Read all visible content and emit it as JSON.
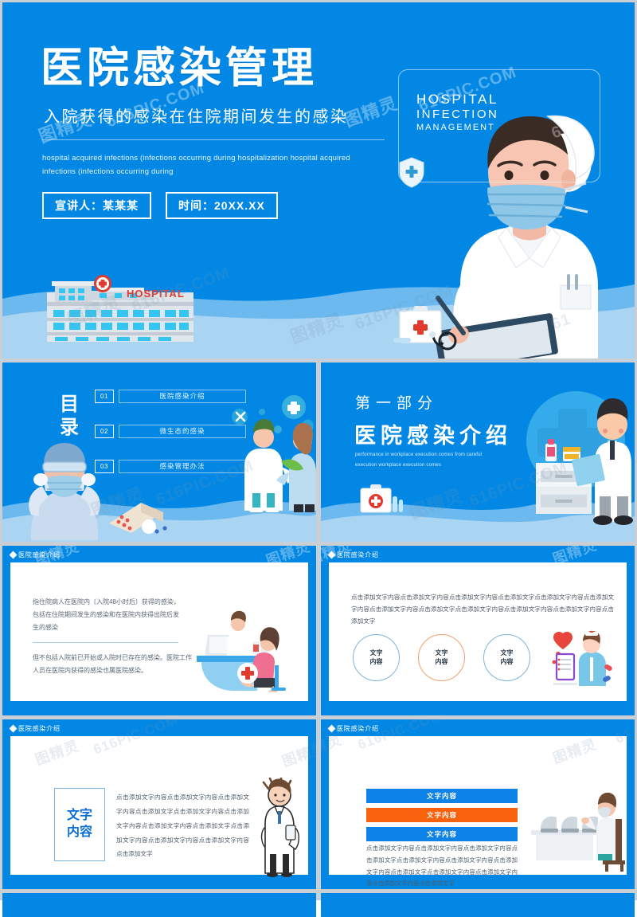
{
  "theme": {
    "primary_blue": "#0288e4",
    "deep_blue": "#0d83e8",
    "orange": "#f9620c",
    "wave_light": "#a9d4f2",
    "white": "#ffffff",
    "body_text": "#4d5a68"
  },
  "watermark": {
    "cn": "图精灵",
    "site": "616PIC.COM",
    "short": "61"
  },
  "title_slide": {
    "main_title": "医院感染管理",
    "sub_title": "入院获得的感染在住院期间发生的感染",
    "english_paragraph": "hospital acquired infections (infections occurring during hospitalization hospital acquired infections (infections occurring during",
    "speaker_tag": "宣讲人：某某某",
    "date_tag": "时间：20XX.XX",
    "panel_line1": "HOSPITAL",
    "panel_line2": "INFECTION",
    "panel_line3": "MANAGEMENT",
    "hospital_sign": "HOSPITAL"
  },
  "toc_slide": {
    "heading": "目录",
    "items": [
      {
        "number": "01",
        "label": "医院感染介绍"
      },
      {
        "number": "02",
        "label": "微生态的感染"
      },
      {
        "number": "03",
        "label": "感染管理办法"
      }
    ]
  },
  "section_slide": {
    "part_label": "第一部分",
    "part_title": "医院感染介绍",
    "english": "performance in workplace execution comes from careful execution workplace execution comes"
  },
  "content_slides": [
    {
      "tag": "医院感染介绍",
      "paragraph_1": "指住院病人在医院内〔入院48小时后〕获得的感染，包括在住院期间发生的感染和在医院内获得出院后发生的感染",
      "paragraph_2": "但不包括入院前已开始或入院时已存在的感染。医院工作人员在医院内获得的感染也属医院感染。"
    },
    {
      "tag": "医院感染介绍",
      "paragraph": "点击添加文字内容点击添加文字内容点击添加文字内容点击添加文字点击添加文字内容点击添加文字内容点击添加文字内容点击添加文字点击添加文字内容点击添加文字内容点击添加文字内容点击添加文字",
      "circles": [
        "文字\n内容",
        "文字\n内容",
        "文字\n内容"
      ],
      "circle_labels": [
        {
          "line1": "文字",
          "line2": "内容"
        },
        {
          "line1": "文字",
          "line2": "内容"
        },
        {
          "line1": "文字",
          "line2": "内容"
        }
      ]
    },
    {
      "tag": "医院感染介绍",
      "box_line1": "文字",
      "box_line2": "内容",
      "paragraph": "点击添加文字内容点击添加文字内容点击添加文字内容点击添加文字点击添加文字内容点击添加文字内容点击添加文字内容点击添加文字点击添加文字内容点击添加文字内容点击添加文字内容点击添加文字"
    },
    {
      "tag": "医院感染介绍",
      "bars": [
        "文字内容",
        "文字内容",
        "文字内容"
      ],
      "paragraph": "点击添加文字内容点击添加文字内容点击添加文字内容点击添加文字点击添加文字内容点击添加文字内容点击添加文字内容点击添加文字点击添加文字内容点击添加文字内容点击添加文字内容点击添加文字"
    }
  ]
}
